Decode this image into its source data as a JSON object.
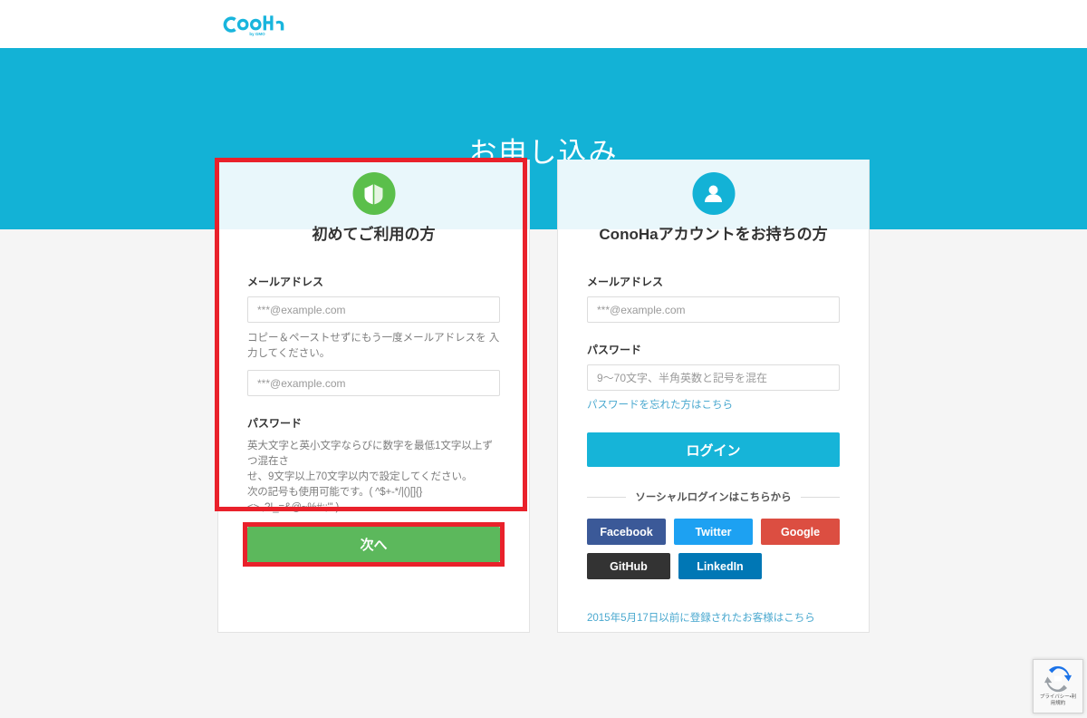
{
  "brand": {
    "logo_text": "ConoHa",
    "logo_subtext": "by GMO",
    "accent_cyan": "#13b2d6",
    "accent_green": "#5cb85c",
    "annotation_red": "#e9212b"
  },
  "hero": {
    "title": "お申し込み"
  },
  "left_card": {
    "icon": "beginner-leaf-icon",
    "icon_color": "#5bbf4b",
    "title": "初めてご利用の方",
    "email_label": "メールアドレス",
    "email_placeholder": "***@example.com",
    "email_value": "",
    "confirm_hint": "コピー＆ペーストせずにもう一度メールアドレスを\n入力してください。",
    "confirm_placeholder": "***@example.com",
    "confirm_value": "",
    "password_label": "パスワード",
    "password_hint_line1": "英大文字と英小文字ならびに数字を最低1文字以上ずつ混在さ",
    "password_hint_line2": "せ、9文字以上70文字以内で設定してください。",
    "password_hint_line3": "次の記号も使用可能です。( ^$+-*/|()[]{}<>.,?!_=&@~%#:;\"' )",
    "password_placeholder": "",
    "password_value": "",
    "next_button": "次へ"
  },
  "right_card": {
    "icon": "person-account-icon",
    "icon_color": "#13b2d6",
    "title": "ConoHaアカウントをお持ちの方",
    "email_label": "メールアドレス",
    "email_placeholder": "***@example.com",
    "email_value": "",
    "password_label": "パスワード",
    "password_placeholder": "9〜70文字、半角英数と記号を混在",
    "password_value": "",
    "forgot_password_link": "パスワードを忘れた方はこちら",
    "login_button": "ログイン",
    "social_divider": "ソーシャルログインはこちらから",
    "social_buttons": [
      {
        "label": "Facebook",
        "color": "#3b5998"
      },
      {
        "label": "Twitter",
        "color": "#1da1f2"
      },
      {
        "label": "Google",
        "color": "#dc4e41"
      },
      {
        "label": "GitHub",
        "color": "#333333"
      },
      {
        "label": "LinkedIn",
        "color": "#0077b5"
      }
    ],
    "legacy_link": "2015年5月17日以前に登録されたお客様はこちら"
  },
  "recaptcha": {
    "icon": "recaptcha-icon",
    "line1": "プライバシー・利",
    "line2": "用規約"
  }
}
